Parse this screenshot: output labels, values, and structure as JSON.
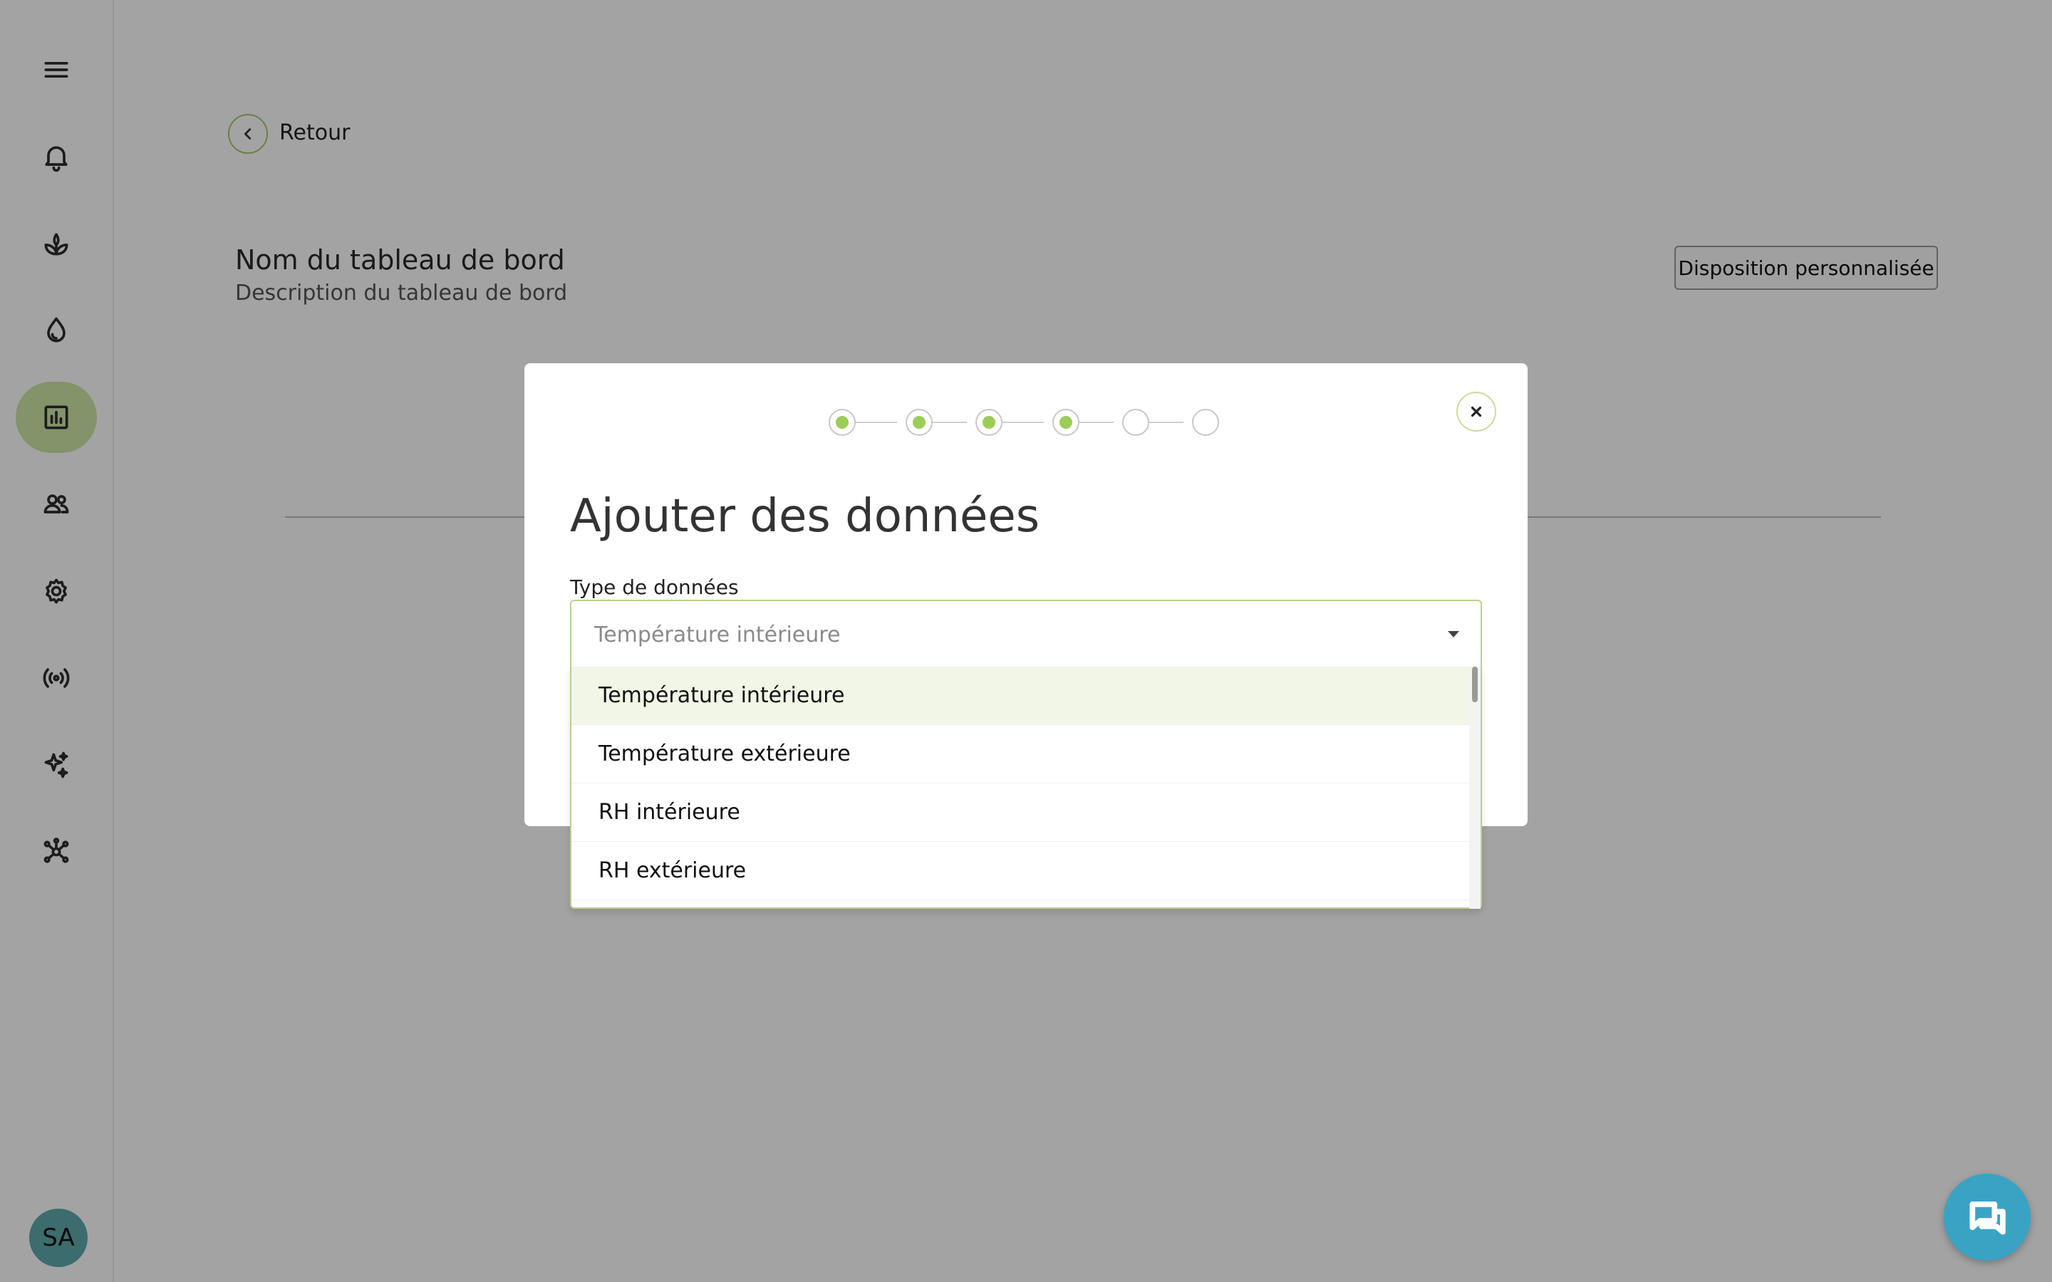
{
  "sidebar": {
    "items": [
      {
        "name": "menu-icon"
      },
      {
        "name": "bell-icon"
      },
      {
        "name": "plant-icon"
      },
      {
        "name": "water-drop-icon"
      },
      {
        "name": "chart-icon",
        "active": true
      },
      {
        "name": "users-icon"
      },
      {
        "name": "gear-icon"
      },
      {
        "name": "broadcast-icon"
      },
      {
        "name": "sparkles-icon"
      },
      {
        "name": "network-icon"
      }
    ],
    "avatar_initials": "SA"
  },
  "page": {
    "back_label": "Retour",
    "dashboard_name": "Nom du tableau de bord",
    "dashboard_description": "Description du tableau de bord",
    "custom_layout_label": "Disposition personnalisée"
  },
  "modal": {
    "title": "Ajouter des données",
    "steps": {
      "total": 6,
      "completed": 4
    },
    "field_label": "Type de données",
    "selected_value": "Température intérieure",
    "options": [
      "Température intérieure",
      "Température extérieure",
      "RH intérieure",
      "RH extérieure"
    ]
  },
  "colors": {
    "accent": "#9bcd57",
    "active_nav": "#cde6a6",
    "chat": "#3aa3c4",
    "avatar": "#5ea9ab"
  }
}
